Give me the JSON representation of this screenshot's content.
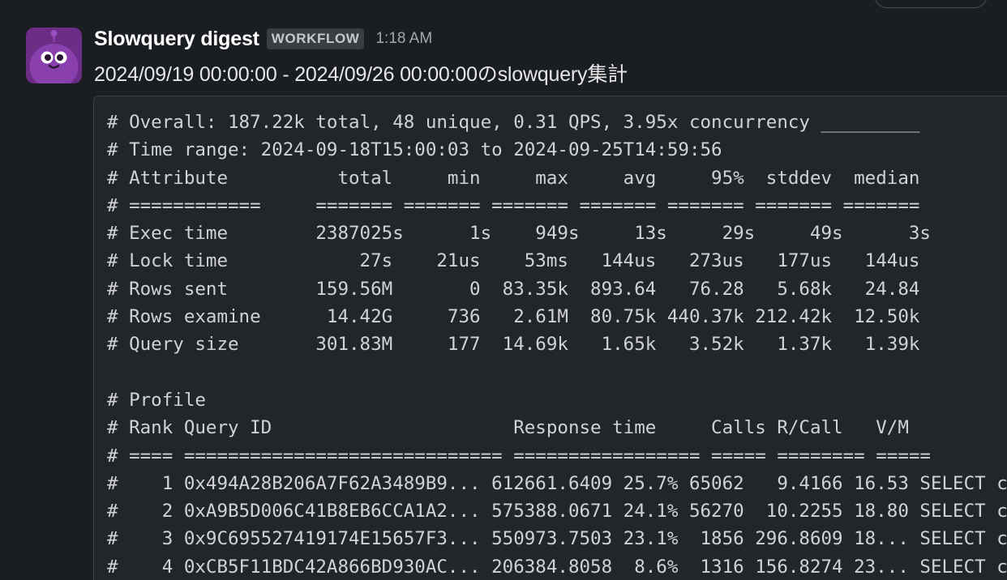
{
  "message": {
    "sender": "Slowquery digest",
    "badge": "WORKFLOW",
    "time": "1:18 AM",
    "title": "2024/09/19 00:00:00 - 2024/09/26 00:00:00のslowquery集計"
  },
  "code_block": {
    "lines": [
      "# Overall: 187.22k total, 48 unique, 0.31 QPS, 3.95x concurrency _________",
      "# Time range: 2024-09-18T15:00:03 to 2024-09-25T14:59:56",
      "# Attribute          total     min     max     avg     95%  stddev  median",
      "# ============     ======= ======= ======= ======= ======= ======= =======",
      "# Exec time        2387025s      1s    949s     13s     29s     49s      3s",
      "# Lock time            27s    21us    53ms   144us   273us   177us   144us",
      "# Rows sent        159.56M       0  83.35k  893.64   76.28   5.68k   24.84",
      "# Rows examine      14.42G     736   2.61M  80.75k 440.37k 212.42k  12.50k",
      "# Query size       301.83M     177  14.69k   1.65k   3.52k   1.37k   1.39k",
      "",
      "# Profile",
      "# Rank Query ID                      Response time     Calls R/Call   V/M",
      "# ==== ============================= ================= ===== ======== =====",
      "#    1 0x494A28B206A7F62A3489B9... 612661.6409 25.7% 65062   9.4166 16.53 SELECT c",
      "#    2 0xA9B5D006C41B8EB6CCA1A2... 575388.0671 24.1% 56270  10.2255 18.80 SELECT c",
      "#    3 0x9C695527419174E15657F3... 550973.7503 23.1%  1856 296.8609 18... SELECT c",
      "#    4 0xCB5F11BDC42A866BD930AC... 206384.8058  8.6%  1316 156.8274 23... SELECT c"
    ]
  },
  "icons": {
    "avatar": "robot-avatar-icon"
  },
  "colors": {
    "background": "#1a1d21",
    "avatar_bg": "#6b2d86",
    "code_bg": "#222529"
  }
}
